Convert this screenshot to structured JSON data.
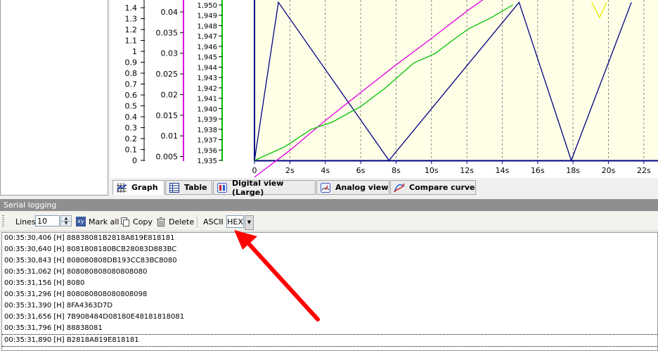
{
  "chart_data": {
    "type": "line",
    "axes": {
      "left1": {
        "ticks": [
          "1.4",
          "1.3",
          "1.2",
          "1.1",
          "1",
          "0.9",
          "0.8",
          "0.7",
          "0.6",
          "0.5",
          "0.4",
          "0.3",
          "0.2",
          "0.1",
          "0"
        ],
        "values": [
          1.4,
          1.3,
          1.2,
          1.1,
          1,
          0.9,
          0.8,
          0.7,
          0.6,
          0.5,
          0.4,
          0.3,
          0.2,
          0.1,
          0
        ]
      },
      "left2": {
        "ticks": [
          "0.04",
          "0.035",
          "0.03",
          "0.025",
          "0.02",
          "0.015",
          "0.01",
          "0.005"
        ],
        "values": [
          0.04,
          0.035,
          0.03,
          0.025,
          0.02,
          0.015,
          0.01,
          0.005
        ],
        "color": "#e000e0"
      },
      "left3": {
        "ticks": [
          "1,950",
          "1,949",
          "1,948",
          "1,947",
          "1,946",
          "1,945",
          "1,944",
          "1,943",
          "1,942",
          "1,941",
          "1,940",
          "1,939",
          "1,938",
          "1,937",
          "1,936",
          "1,935"
        ],
        "values": [
          1950,
          1949,
          1948,
          1947,
          1946,
          1945,
          1944,
          1943,
          1942,
          1941,
          1940,
          1939,
          1938,
          1937,
          1936,
          1935
        ],
        "color": "#00c000"
      },
      "x": {
        "ticks": [
          "0",
          "2s",
          "4s",
          "6s",
          "8s",
          "10s",
          "12s",
          "14s",
          "16s",
          "18s",
          "20s",
          "22s"
        ],
        "values": [
          0,
          2,
          4,
          6,
          8,
          10,
          12,
          14,
          16,
          18,
          20,
          22
        ],
        "range": [
          0,
          22.8
        ]
      }
    },
    "series": [
      {
        "color": "#000080",
        "axis": "left1",
        "x": [
          0,
          1.35,
          7.6,
          14.95,
          17.9,
          21.3
        ],
        "y": [
          0,
          1.45,
          0,
          1.45,
          0,
          1.45
        ]
      },
      {
        "color": "#e000e0",
        "axis": "left2",
        "x": [
          0,
          2,
          4,
          6,
          8,
          10,
          12,
          14,
          14.6
        ],
        "y": [
          0,
          0.0065,
          0.0137,
          0.0205,
          0.0272,
          0.0336,
          0.0402,
          0.0463,
          0.0478
        ]
      },
      {
        "color": "#00c000",
        "axis": "left3",
        "x": [
          0,
          1.7,
          3.2,
          4.4,
          6,
          7.4,
          9,
          10.2,
          11.2,
          12.1,
          13.4,
          14.6
        ],
        "y": [
          1935,
          1936.3,
          1938,
          1938.7,
          1940.2,
          1942,
          1944.4,
          1945.3,
          1946.6,
          1947.7,
          1948.8,
          1950
        ]
      },
      {
        "color": "#e8e800",
        "axis": "left1",
        "x": [
          19.05,
          19.5,
          19.9
        ],
        "y": [
          1.45,
          1.31,
          1.45
        ]
      }
    ],
    "grid": true,
    "background": "#ffffe8"
  },
  "tabs": [
    {
      "label": "Graph",
      "icon": "graph-icon",
      "active": true
    },
    {
      "label": "Table",
      "icon": "table-icon",
      "active": false
    },
    {
      "label": "Digital view (Large)",
      "icon": "digital-view-icon",
      "active": false
    },
    {
      "label": "Analog view",
      "icon": "analog-view-icon",
      "active": false
    },
    {
      "label": "Compare curve",
      "icon": "compare-curve-icon",
      "active": false
    }
  ],
  "serial": {
    "title": "Serial logging",
    "lines_label": "Lines",
    "lines_value": "10",
    "mark_all": "Mark all",
    "mark_all_icon": "xy",
    "copy": "Copy",
    "delete": "Delete",
    "ascii": "ASCII",
    "hex": "HEX",
    "log": [
      "00:35:30,406 [H] 88838081B2818A819E818181",
      "00:35:30,640 [H] 8081808180BCB28083D883BC",
      "00:35:30,843 [H] 808080808DB193CC83BC8080",
      "00:35:31,062 [H] 808080808080808080",
      "00:35:31,156 [H] 8080",
      "00:35:31,296 [H] 808080808080808098",
      "00:35:31,390 [H] 8FA4363D7D",
      "00:35:31,656 [H] 7B908484D08180E48181818081",
      "00:35:31,796 [H] 88838081",
      "00:35:31,890 [H] B2818A819E818181"
    ]
  },
  "colors": {
    "arrow": "#ff0000",
    "header_bg": "#8f8f8f"
  }
}
